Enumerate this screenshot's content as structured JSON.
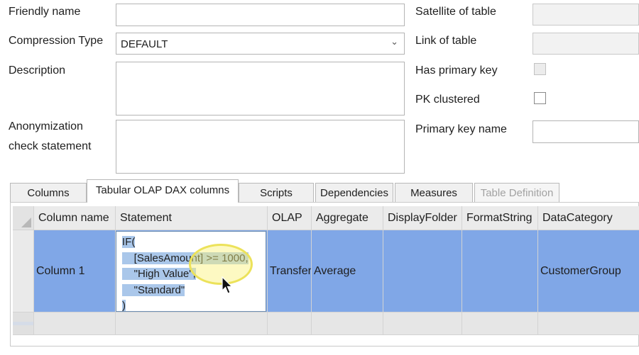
{
  "form": {
    "friendly_name_label": "Friendly name",
    "friendly_name_value": "",
    "compression_label": "Compression Type",
    "compression_value": "DEFAULT",
    "description_label": "Description",
    "description_value": "",
    "anonymization_label_1": "Anonymization",
    "anonymization_label_2": "check statement",
    "anonymization_value": "",
    "satellite_label": "Satellite of table",
    "satellite_value": "",
    "link_label": "Link of table",
    "link_value": "",
    "has_pk_label": "Has primary key",
    "has_pk_checked": false,
    "pk_clustered_label": "PK clustered",
    "pk_clustered_checked": false,
    "pk_name_label": "Primary key name",
    "pk_name_value": ""
  },
  "tabs": [
    {
      "label": "Columns",
      "active": false,
      "enabled": true
    },
    {
      "label": "Tabular OLAP DAX columns",
      "active": true,
      "enabled": true
    },
    {
      "label": "Scripts",
      "active": false,
      "enabled": true
    },
    {
      "label": "Dependencies",
      "active": false,
      "enabled": true
    },
    {
      "label": "Measures",
      "active": false,
      "enabled": true
    },
    {
      "label": "Table Definition",
      "active": false,
      "enabled": false
    }
  ],
  "grid": {
    "headers": [
      "Column name",
      "Statement",
      "OLAP",
      "Aggregate",
      "DisplayFolder",
      "FormatString",
      "DataCategory"
    ],
    "row": {
      "column_name": "Column 1",
      "statement_lines": [
        "IF(",
        "    [SalesAmount] >= 1000,",
        "    \"High Value\",",
        "    \"Standard\"",
        ")"
      ],
      "olap": "Transfer",
      "aggregate": "Average",
      "display_folder": "",
      "format_string": "",
      "data_category": "CustomerGroup"
    }
  },
  "colors": {
    "selection": "#80a7e7",
    "text_highlight": "#aac7ea",
    "cursor_highlight": "#ece25a"
  }
}
